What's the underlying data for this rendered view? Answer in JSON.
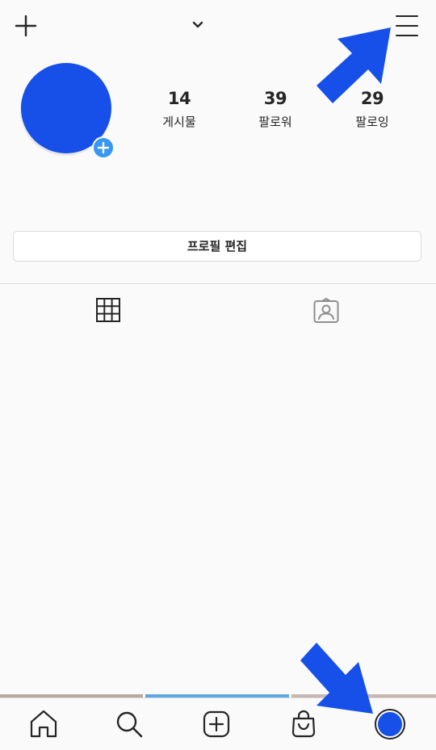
{
  "topbar": {
    "new_post_icon": "plus-icon",
    "account_switcher_icon": "chevron-down-icon",
    "menu_icon": "hamburger-menu-icon"
  },
  "profile": {
    "avatar_color": "#1650e9",
    "add_story_icon": "plus-badge-icon",
    "stats": [
      {
        "value": "14",
        "label": "게시물"
      },
      {
        "value": "39",
        "label": "팔로워"
      },
      {
        "value": "29",
        "label": "팔로잉"
      }
    ],
    "edit_profile_label": "프로필 편집"
  },
  "tabs": [
    {
      "icon": "grid-icon",
      "active": true
    },
    {
      "icon": "tagged-person-icon",
      "active": false
    }
  ],
  "bottom_nav": [
    {
      "icon": "home-icon"
    },
    {
      "icon": "search-icon"
    },
    {
      "icon": "new-post-icon"
    },
    {
      "icon": "shopping-bag-icon"
    },
    {
      "icon": "profile-avatar-icon"
    }
  ],
  "colors": {
    "annotation_arrow": "#1650e9",
    "accent_blue": "#3897f0",
    "text": "#262626",
    "border": "#dbdbdb"
  }
}
